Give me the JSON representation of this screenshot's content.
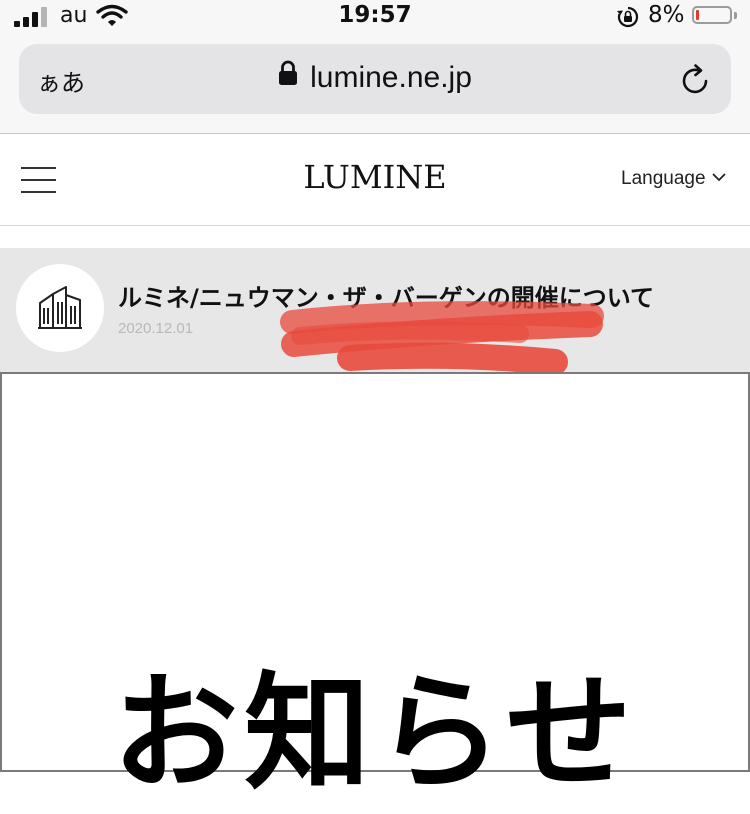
{
  "status_bar": {
    "carrier": "au",
    "time": "19:57",
    "battery_percent_label": "8%",
    "battery_level": 0.08,
    "battery_color": "#e03a2e",
    "icons": [
      "signal-icon",
      "wifi-icon",
      "rotation-lock-icon",
      "battery-icon"
    ]
  },
  "browser": {
    "aa_label": "ぁあ",
    "url": "lumine.ne.jp",
    "icons": [
      "lock-icon",
      "reload-icon"
    ]
  },
  "site_header": {
    "logo": "LUMINE",
    "language_label": "Language",
    "icons": [
      "menu-icon",
      "chevron-down-icon"
    ]
  },
  "news_item": {
    "title": "ルミネ/ニュウマン・ザ・バーゲンの開催について",
    "date": "2020.12.01",
    "icon": "building-icon",
    "redaction_color": "#e84a3c"
  },
  "notice_image": {
    "heading": "お知らせ"
  }
}
